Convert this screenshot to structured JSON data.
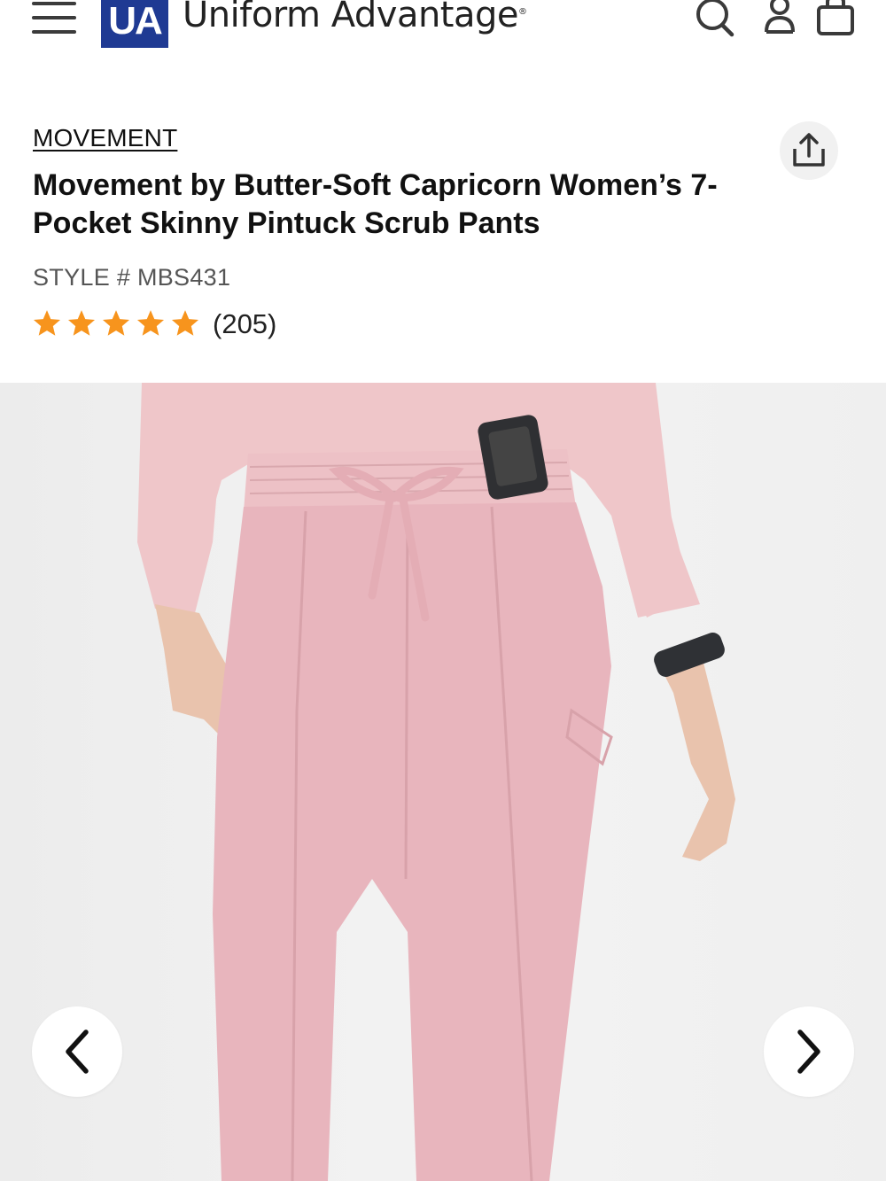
{
  "header": {
    "logo_mark": "UA",
    "logo_text": "Uniform Advantage",
    "logo_trademark": "®",
    "icons": [
      "menu-icon",
      "search-icon",
      "account-icon",
      "bag-icon"
    ]
  },
  "product": {
    "brand": "MOVEMENT",
    "title": "Movement by Butter-Soft Capricorn Women’s 7-Pocket Skinny Pintuck Scrub Pants",
    "style": "STYLE # MBS431",
    "rating": 5,
    "rating_max": 5,
    "review_count": "(205)",
    "share_icon": "share-icon"
  },
  "gallery": {
    "prev_icon": "chevron-left-icon",
    "next_icon": "chevron-right-icon"
  },
  "colors": {
    "brand_blue": "#1f3a93",
    "star": "#f7941d",
    "pants_pink": "#e8b5bd"
  }
}
